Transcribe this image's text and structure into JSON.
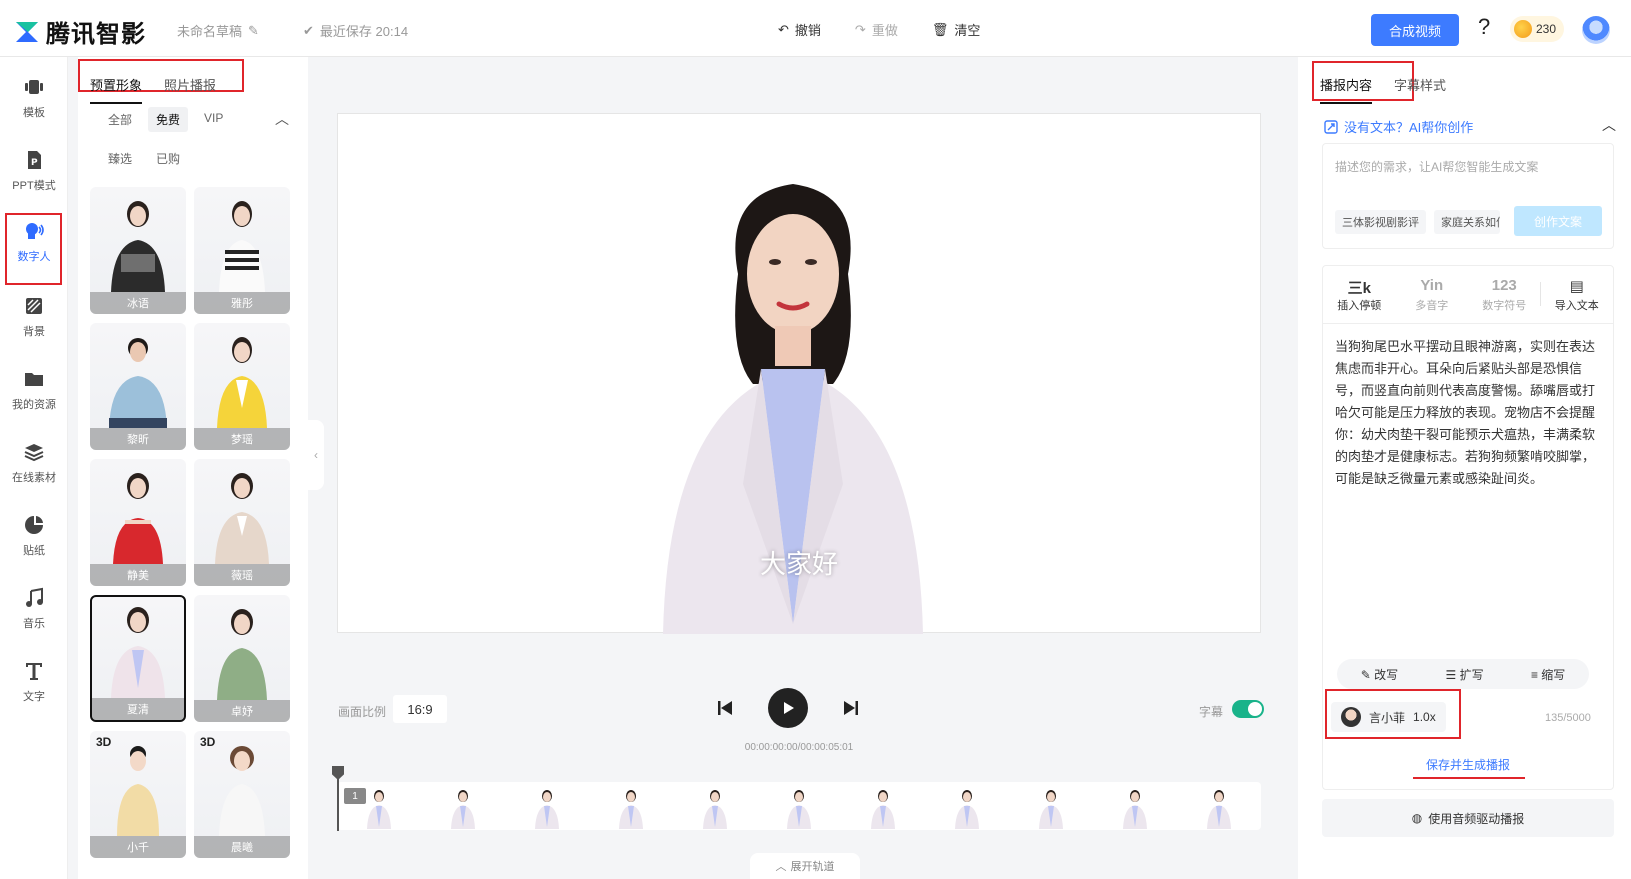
{
  "topbar": {
    "logo_text": "腾讯智影",
    "draft_name": "未命名草稿",
    "saved_text": "最近保存 20:14",
    "undo": "撤销",
    "redo": "重做",
    "clear": "清空",
    "compose_button": "合成视频",
    "help": "?",
    "coins": "230"
  },
  "leftnav": {
    "items": [
      {
        "label": "模板",
        "icon": "template-icon"
      },
      {
        "label": "PPT模式",
        "icon": "ppt-icon"
      },
      {
        "label": "数字人",
        "icon": "digital-human-icon"
      },
      {
        "label": "背景",
        "icon": "background-icon"
      },
      {
        "label": "我的资源",
        "icon": "folder-icon"
      },
      {
        "label": "在线素材",
        "icon": "layers-icon"
      },
      {
        "label": "贴纸",
        "icon": "sticker-icon"
      },
      {
        "label": "音乐",
        "icon": "music-icon"
      },
      {
        "label": "文字",
        "icon": "text-icon"
      }
    ],
    "active_index": 2
  },
  "avatar_panel": {
    "tabs": [
      "预置形象",
      "照片播报"
    ],
    "filter_row1": [
      "全部",
      "免费",
      "VIP"
    ],
    "filter_row2": [
      "臻选",
      "已购"
    ],
    "cards": [
      {
        "name": "冰语",
        "tag": ""
      },
      {
        "name": "雅彤",
        "tag": ""
      },
      {
        "name": "黎昕",
        "tag": ""
      },
      {
        "name": "梦瑶",
        "tag": ""
      },
      {
        "name": "静美",
        "tag": ""
      },
      {
        "name": "薇瑶",
        "tag": ""
      },
      {
        "name": "夏清",
        "tag": ""
      },
      {
        "name": "卓妤",
        "tag": ""
      },
      {
        "name": "小千",
        "tag": "3D"
      },
      {
        "name": "晨曦",
        "tag": "3D"
      }
    ]
  },
  "canvas": {
    "subtitle": "大家好"
  },
  "playback": {
    "ratio_label": "画面比例",
    "ratio_value": "16:9",
    "time": "00:00:00:00/00:00:05:01",
    "subtitle_label": "字幕",
    "segment_number": "1",
    "expand_track": "展开轨道"
  },
  "right_panel": {
    "tabs": [
      "播报内容",
      "字幕样式"
    ],
    "ai_head": "没有文本？AI帮你创作",
    "ai_placeholder": "描述您的需求，让AI帮您智能生成文案",
    "ai_chips": [
      "三体影视剧影评",
      "家庭关系如何维护"
    ],
    "ai_generate": "创作文案",
    "tools": [
      {
        "icon_text": "三k",
        "label": "插入停顿"
      },
      {
        "icon_text": "Yin",
        "label": "多音字"
      },
      {
        "icon_text": "123",
        "label": "数字符号"
      },
      {
        "icon_text": "▤",
        "label": "导入文本"
      }
    ],
    "body_text": "当狗狗尾巴水平摆动且眼神游离，实则在表达焦虑而非开心。耳朵向后紧贴头部是恐惧信号，而竖直向前则代表高度警惕。舔嘴唇或打哈欠可能是压力释放的表现。宠物店不会提醒你：幼犬肉垫干裂可能预示犬瘟热，丰满柔软的肉垫才是健康标志。若狗狗频繁啃咬脚掌，可能是缺乏微量元素或感染趾间炎。",
    "rewrite": [
      "改写",
      "扩写",
      "缩写"
    ],
    "voice_name": "言小菲",
    "voice_speed": "1.0x",
    "char_count": "135/5000",
    "save_generate": "保存并生成播报",
    "audio_drive": "使用音频驱动播报"
  },
  "colors": {
    "accent": "#3d7bff",
    "highlight_box": "#e0252b",
    "toggle_on": "#19b38a"
  }
}
